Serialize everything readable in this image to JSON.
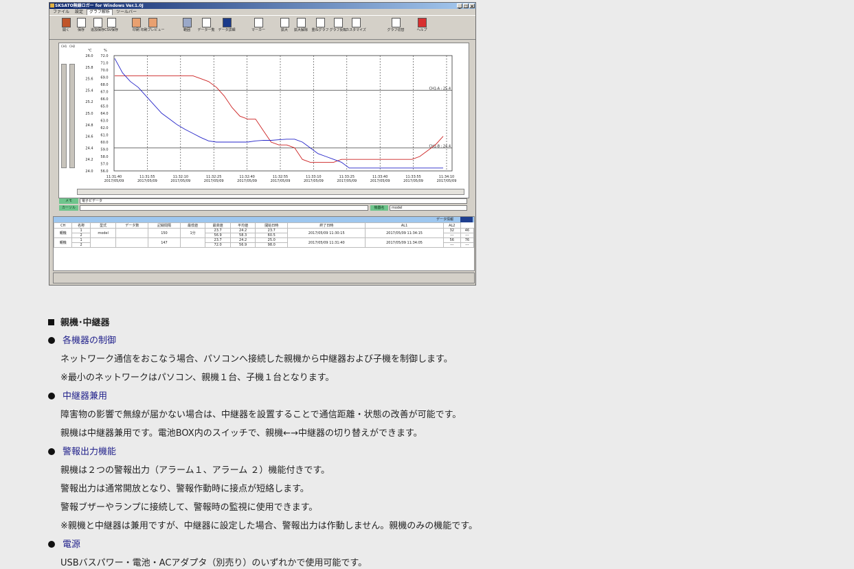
{
  "app": {
    "title": "SKSATO無線ロガー for Windows Ver.1.0J",
    "window_buttons": [
      "_",
      "□",
      "×"
    ],
    "menu": [
      "ファイル",
      "設定",
      "グラフ解析",
      "ツールバー"
    ],
    "toolbar": [
      "開く",
      "保存",
      "追加保存",
      "CSV保存",
      "印刷",
      "印刷プレビュー",
      "範囲",
      "データ一覧",
      "データ詳細",
      "マーカー",
      "拡大",
      "拡大解除",
      "重ねグラフ",
      "グラフ反転",
      "カスタマイズ",
      "グラフ切替",
      "ヘルプ"
    ],
    "channel_labels": [
      "CH1",
      "CH2"
    ],
    "y_unit_labels": [
      "℃",
      "%"
    ],
    "memo_label": "メモ",
    "memo_value": "電子ビデータ",
    "cursor_label": "カーソル",
    "select_label": "機器名",
    "select_value": "model",
    "table_header_label": "データ情報",
    "table_columns": [
      "CH",
      "名称",
      "型式",
      "データ数",
      "記録間隔",
      "最低値",
      "最高値",
      "平均値",
      "開始日時",
      "終了日時",
      "AL1",
      "AL2"
    ],
    "table_groups": [
      {
        "group": "親機",
        "name": "model",
        "count": "150",
        "interval": "1分",
        "rows": [
          {
            "ch": "1",
            "min": "23.7",
            "max": "24.2",
            "avg": "23.7"
          },
          {
            "ch": "2",
            "min": "56.9",
            "max": "58.3",
            "avg": "60.5"
          }
        ],
        "start": "2017/05/09 11:30:15",
        "end": "2017/05/09 11:34:15",
        "al1": [
          "32",
          "---"
        ],
        "al2": [
          "46",
          "---"
        ]
      },
      {
        "group": "親機",
        "name": "",
        "count": "147",
        "interval": "",
        "rows": [
          {
            "ch": "1",
            "min": "23.7",
            "max": "24.2",
            "avg": "25.0"
          },
          {
            "ch": "2",
            "min": "72.0",
            "max": "56.9",
            "avg": "98.0"
          }
        ],
        "start": "2017/05/09 11:31:40",
        "end": "2017/05/09 11:34:05",
        "al1": [
          "56",
          "---"
        ],
        "al2": [
          "76",
          "---"
        ]
      }
    ]
  },
  "chart_data": {
    "type": "line",
    "y1_ticks": [
      "26.0",
      "25.8",
      "25.6",
      "25.4",
      "25.2",
      "25.0",
      "24.8",
      "24.6",
      "24.4",
      "24.2",
      "24.0"
    ],
    "y2_ticks": [
      "72.0",
      "71.0",
      "70.0",
      "69.0",
      "68.0",
      "67.0",
      "66.0",
      "65.0",
      "64.0",
      "63.0",
      "62.0",
      "61.0",
      "60.0",
      "59.0",
      "58.0",
      "57.0",
      "56.0"
    ],
    "x_ticks": [
      {
        "t": "11:31:40",
        "d": "2017/05/09"
      },
      {
        "t": "11:31:55",
        "d": "2017/05/09"
      },
      {
        "t": "11:32:10",
        "d": "2017/05/09"
      },
      {
        "t": "11:32:25",
        "d": "2017/05/09"
      },
      {
        "t": "11:32:40",
        "d": "2017/05/09"
      },
      {
        "t": "11:32:55",
        "d": "2017/05/09"
      },
      {
        "t": "11:33:10",
        "d": "2017/05/09"
      },
      {
        "t": "11:33:25",
        "d": "2017/05/09"
      },
      {
        "t": "11:33:40",
        "d": "2017/05/09"
      },
      {
        "t": "11:33:55",
        "d": "2017/05/09"
      },
      {
        "t": "11:34:10",
        "d": "2017/05/09"
      }
    ],
    "ref_lines": [
      {
        "label": "CH1-A : 25.4",
        "value": 25.4
      },
      {
        "label": "CH1-B : 24.4",
        "value": 24.4
      }
    ],
    "series": [
      {
        "color": "#cc2020",
        "axis": "y1",
        "values": [
          25.65,
          25.65,
          25.65,
          25.65,
          25.65,
          25.65,
          25.65,
          25.65,
          25.65,
          25.65,
          25.65,
          25.6,
          25.55,
          25.45,
          25.3,
          25.1,
          24.95,
          24.9,
          24.9,
          24.7,
          24.5,
          24.45,
          24.45,
          24.4,
          24.2,
          24.15,
          24.15,
          24.15,
          24.15,
          24.2,
          24.2,
          24.2,
          24.2,
          24.2,
          24.2,
          24.2,
          24.2,
          24.2,
          24.2,
          24.25,
          24.35,
          24.45,
          24.6
        ]
      },
      {
        "color": "#2323c8",
        "axis": "y1",
        "values": [
          25.95,
          25.7,
          25.55,
          25.45,
          25.3,
          25.15,
          25.0,
          24.9,
          24.8,
          24.72,
          24.65,
          24.58,
          24.52,
          24.5,
          24.5,
          24.5,
          24.5,
          24.5,
          24.52,
          24.53,
          24.53,
          24.54,
          24.55,
          24.55,
          24.5,
          24.4,
          24.3,
          24.25,
          24.2,
          24.15,
          24.05,
          24.05,
          24.05,
          24.05,
          24.05,
          24.05,
          24.05,
          24.05,
          24.05,
          24.05,
          24.05,
          24.05,
          24.05
        ]
      }
    ],
    "ylim": [
      24.0,
      26.0
    ],
    "grid": true
  },
  "content": {
    "heading": "親機･中継器",
    "sections": [
      {
        "title": "各機器の制御",
        "paragraphs": [
          "ネットワーク通信をおこなう場合、パソコンへ接続した親機から中継器および子機を制御します。",
          "※最小のネットワークはパソコン、親機１台、子機１台となります。"
        ]
      },
      {
        "title": "中継器兼用",
        "paragraphs": [
          "障害物の影響で無線が届かない場合は、中継器を設置することで通信距離・状態の改善が可能です。",
          "親機は中継器兼用です。電池BOX内のスイッチで、親機←→中継器の切り替えができます。"
        ]
      },
      {
        "title": "警報出力機能",
        "paragraphs": [
          "親機は２つの警報出力（アラーム１、アラーム ２）機能付きです。",
          "警報出力は通常開放となり、警報作動時に接点が短絡します。",
          "警報ブザーやランプに接続して、警報時の監視に使用できます。",
          "※親機と中継器は兼用ですが、中継器に設定した場合、警報出力は作動しません。親機のみの機能です。"
        ]
      },
      {
        "title": "電源",
        "paragraphs": [
          "USBバスパワー・電池・ACアダプタ（別売り）のいずれかで使用可能です。"
        ]
      }
    ]
  }
}
